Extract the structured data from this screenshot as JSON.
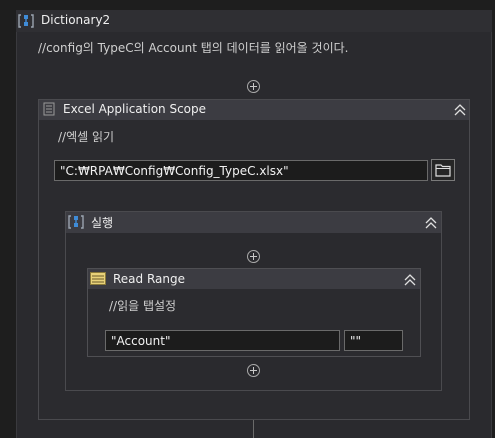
{
  "outer": {
    "title": "Dictionary2",
    "comment": "//config의 TypeC의 Account 탭의 데이터를 읽어올 것이다."
  },
  "excel_scope": {
    "title": "Excel Application Scope",
    "comment": "//엑셀 읽기",
    "workbook_path": "\"C:₩RPA₩Config₩Config_TypeC.xlsx\""
  },
  "execute": {
    "title": "실행"
  },
  "read_range": {
    "title": "Read Range",
    "comment": "//읽을 탭설정",
    "sheet_name": "\"Account\"",
    "range": "\"\""
  },
  "icons": {
    "sequence": "sequence-icon",
    "excel_scope": "excel-scope-icon",
    "read_range": "read-range-icon",
    "folder": "folder-icon",
    "collapse": "collapse-chevrons-icon",
    "add": "add-activity-icon"
  },
  "colors": {
    "sequence_blue": "#3f8cd8",
    "read_range_yellow": "#e8d27a"
  }
}
